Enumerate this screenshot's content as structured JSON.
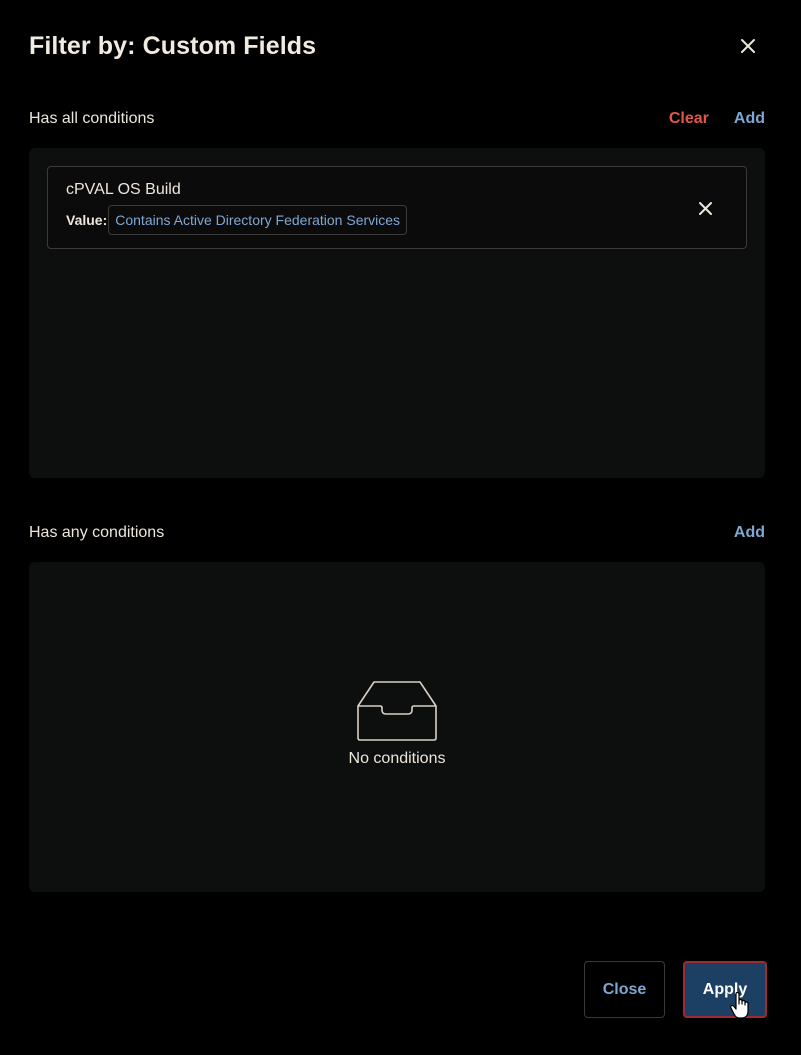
{
  "dialog": {
    "title": "Filter by: Custom Fields",
    "close_icon": "close-icon"
  },
  "all_conditions": {
    "label": "Has all conditions",
    "clear_label": "Clear",
    "add_label": "Add",
    "items": [
      {
        "name": "cPVAL OS Build",
        "value_label": "Value:",
        "value": "Contains Active Directory Federation Services"
      }
    ]
  },
  "any_conditions": {
    "label": "Has any conditions",
    "add_label": "Add",
    "empty_icon": "inbox-icon",
    "empty_text": "No conditions"
  },
  "footer": {
    "close_label": "Close",
    "apply_label": "Apply"
  },
  "colors": {
    "background": "#000000",
    "panel": "#0d0e0e",
    "text": "#ece6dc",
    "link_blue": "#7fa7d4",
    "clear_red": "#e0574c",
    "apply_bg": "#1c3f64",
    "apply_border": "#a12a32"
  }
}
